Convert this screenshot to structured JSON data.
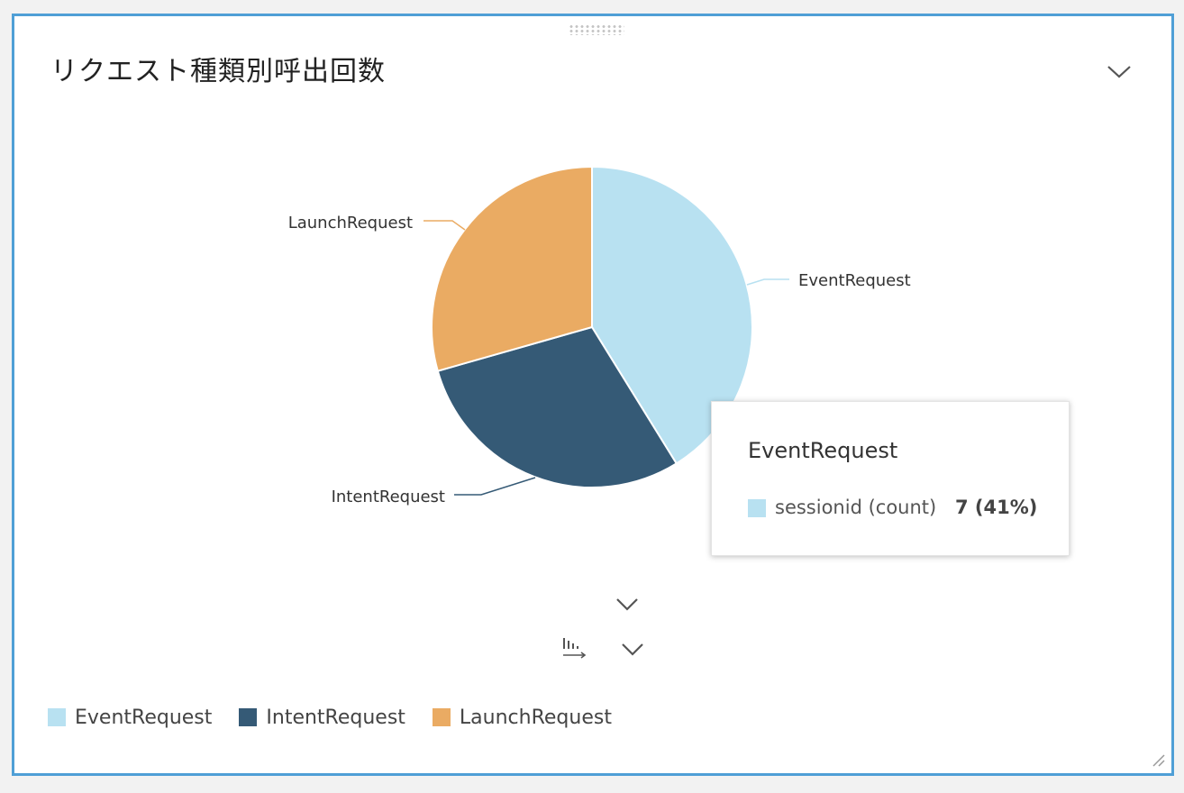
{
  "panel": {
    "title": "リクエスト種類別呼出回数"
  },
  "icons": {
    "panel_menu": "chevron-down-icon",
    "drag_handle": "drag-dots-icon",
    "expand": "chevron-down-icon",
    "sort": "sort-bars-icon",
    "sort_menu": "chevron-down-icon",
    "resize": "resize-grip-icon"
  },
  "chart_data": {
    "type": "pie",
    "title": "",
    "slices": [
      {
        "label": "EventRequest",
        "value": 7,
        "color": "#b8e1f1"
      },
      {
        "label": "IntentRequest",
        "value": 5,
        "color": "#355a76"
      },
      {
        "label": "LaunchRequest",
        "value": 5,
        "color": "#eaab63"
      }
    ],
    "legend_position": "bottom-left"
  },
  "tooltip": {
    "title": "EventRequest",
    "metric": "sessionid (count)",
    "value": "7 (41%)",
    "color": "#b8e1f1"
  },
  "colors": {
    "panel_border": "#4f9fd6"
  }
}
